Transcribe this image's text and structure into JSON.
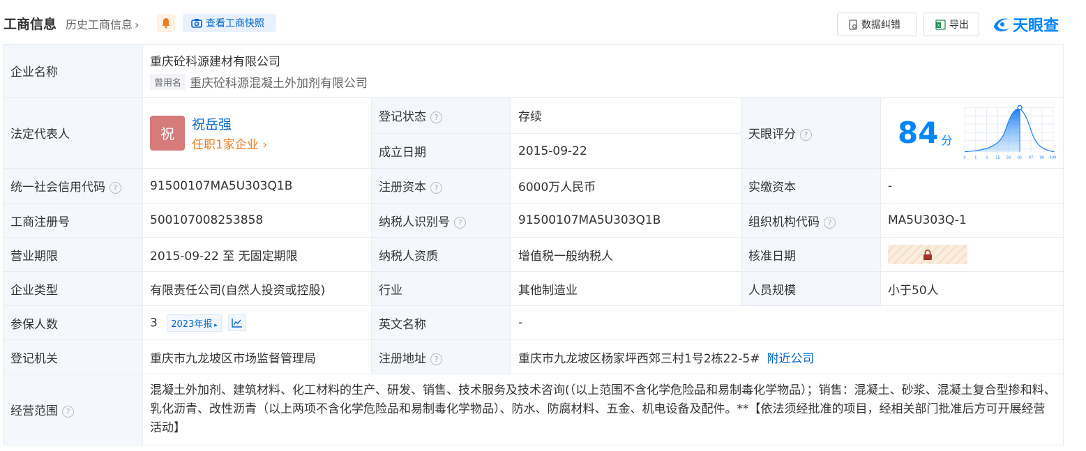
{
  "header": {
    "title": "工商信息",
    "history": "历史工商信息",
    "snapshot": "查看工商快照",
    "error_btn": "数据纠错",
    "export_btn": "导出",
    "logo": "天眼查"
  },
  "colors": {
    "accent": "#0084ff",
    "link": "#0066cc",
    "status": "#11a660",
    "orange": "#f07a1e",
    "label_bg": "#f4f8fd"
  },
  "company": {
    "name_label": "企业名称",
    "name": "重庆砼科源建材有限公司",
    "former_tag": "曾用名",
    "former_name": "重庆砼科源混凝土外加剂有限公司",
    "legal_label": "法定代表人",
    "legal_avatar": "祝",
    "legal_name": "祝岳强",
    "legal_positions": "任职1家企业",
    "reg_status_label": "登记状态",
    "reg_status": "存续",
    "est_date_label": "成立日期",
    "est_date": "2015-09-22",
    "score_label": "天眼评分",
    "score": "84",
    "score_unit": "分",
    "score_axis": [
      "0",
      "1",
      "3",
      "15",
      "50",
      "85",
      "97",
      "99",
      "100"
    ],
    "credit_code_label": "统一社会信用代码",
    "credit_code": "91500107MA5U303Q1B",
    "reg_capital_label": "注册资本",
    "reg_capital": "6000万人民币",
    "paid_capital_label": "实缴资本",
    "paid_capital": "-",
    "reg_no_label": "工商注册号",
    "reg_no": "500107008253858",
    "taxpayer_id_label": "纳税人识别号",
    "taxpayer_id": "91500107MA5U303Q1B",
    "org_code_label": "组织机构代码",
    "org_code": "MA5U303Q-1",
    "term_label": "营业期限",
    "term": "2015-09-22 至 无固定期限",
    "tax_qual_label": "纳税人资质",
    "tax_qual": "增值税一般纳税人",
    "approve_date_label": "核准日期",
    "type_label": "企业类型",
    "type": "有限责任公司(自然人投资或控股)",
    "industry_label": "行业",
    "industry": "其他制造业",
    "staff_label": "人员规模",
    "staff": "小于50人",
    "insured_label": "参保人数",
    "insured": "3",
    "insured_report": "2023年报",
    "en_name_label": "英文名称",
    "en_name": "-",
    "authority_label": "登记机关",
    "authority": "重庆市九龙坡区市场监督管理局",
    "address_label": "注册地址",
    "address": "重庆市九龙坡区杨家坪西郊三村1号2栋22-5#",
    "nearby": "附近公司",
    "scope_label": "经营范围",
    "scope": "混凝土外加剂、建筑材料、化工材料的生产、研发、销售、技术服务及技术咨询(（以上范围不含化学危险品和易制毒化学物品）；销售：混凝土、砂浆、混凝土复合型掺和料、乳化沥青、改性沥青（以上两项不含化学危险品和易制毒化学物品）、防水、防腐材料、五金、机电设备及配件。**【依法须经批准的项目，经相关部门批准后方可开展经营活动】"
  }
}
